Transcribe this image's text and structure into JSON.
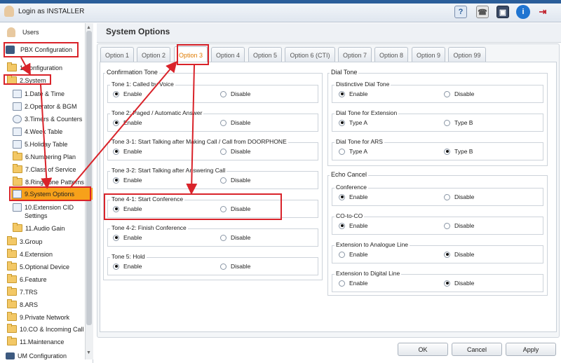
{
  "header": {
    "login_text": "Login as INSTALLER",
    "toolbar_icons": [
      "help-icon",
      "phone-icon",
      "save-icon",
      "info-icon",
      "logout-icon"
    ]
  },
  "sidebar": {
    "items": [
      {
        "label": "Users"
      },
      {
        "label": "PBX Configuration"
      },
      {
        "label": "1.Configuration"
      },
      {
        "label": "2.System"
      },
      {
        "label": "1.Date & Time"
      },
      {
        "label": "2.Operator & BGM"
      },
      {
        "label": "3.Timers & Counters"
      },
      {
        "label": "4.Week Table"
      },
      {
        "label": "5.Holiday Table"
      },
      {
        "label": "6.Numbering Plan"
      },
      {
        "label": "7.Class of Service"
      },
      {
        "label": "8.Ring Tone Patterns"
      },
      {
        "label": "9.System Options"
      },
      {
        "label": "10.Extension CID Settings"
      },
      {
        "label": "11.Audio Gain"
      },
      {
        "label": "3.Group"
      },
      {
        "label": "4.Extension"
      },
      {
        "label": "5.Optional Device"
      },
      {
        "label": "6.Feature"
      },
      {
        "label": "7.TRS"
      },
      {
        "label": "8.ARS"
      },
      {
        "label": "9.Private Network"
      },
      {
        "label": "10.CO & Incoming Call"
      },
      {
        "label": "11.Maintenance"
      },
      {
        "label": "UM Configuration"
      }
    ]
  },
  "main": {
    "title": "System Options",
    "tabs": [
      "Option 1",
      "Option 2",
      "Option 3",
      "Option 4",
      "Option 5",
      "Option 6 (CTI)",
      "Option 7",
      "Option 8",
      "Option 9",
      "Option 99"
    ],
    "active_tab": "Option 3",
    "confirmation_tone": {
      "title": "Confirmation Tone",
      "groups": [
        {
          "title": "Tone 1: Called by Voice",
          "options": [
            "Enable",
            "Disable"
          ],
          "selected": "Enable"
        },
        {
          "title": "Tone 2: Paged / Automatic Answer",
          "options": [
            "Enable",
            "Disable"
          ],
          "selected": "Enable"
        },
        {
          "title": "Tone 3-1: Start Talking after Making Call / Call from DOORPHONE",
          "options": [
            "Enable",
            "Disable"
          ],
          "selected": "Enable"
        },
        {
          "title": "Tone 3-2: Start Talking after Answering Call",
          "options": [
            "Enable",
            "Disable"
          ],
          "selected": "Enable"
        },
        {
          "title": "Tone 4-1: Start Conference",
          "options": [
            "Enable",
            "Disable"
          ],
          "selected": "Enable"
        },
        {
          "title": "Tone 4-2: Finish Conference",
          "options": [
            "Enable",
            "Disable"
          ],
          "selected": "Enable"
        },
        {
          "title": "Tone 5: Hold",
          "options": [
            "Enable",
            "Disable"
          ],
          "selected": "Enable"
        }
      ]
    },
    "dial_tone": {
      "title": "Dial Tone",
      "groups": [
        {
          "title": "Distinctive Dial Tone",
          "options": [
            "Enable",
            "Disable"
          ],
          "selected": "Enable"
        },
        {
          "title": "Dial Tone for Extension",
          "options": [
            "Type A",
            "Type B"
          ],
          "selected": "Type A"
        },
        {
          "title": "Dial Tone for ARS",
          "options": [
            "Type A",
            "Type B"
          ],
          "selected": "Type B"
        }
      ]
    },
    "echo_cancel": {
      "title": "Echo Cancel",
      "groups": [
        {
          "title": "Conference",
          "options": [
            "Enable",
            "Disable"
          ],
          "selected": "Enable"
        },
        {
          "title": "CO-to-CO",
          "options": [
            "Enable",
            "Disable"
          ],
          "selected": "Enable"
        },
        {
          "title": "Extension to Analogue Line",
          "options": [
            "Enable",
            "Disable"
          ],
          "selected": "Disable"
        },
        {
          "title": "Extension to Digital Line",
          "options": [
            "Enable",
            "Disable"
          ],
          "selected": "Disable"
        }
      ]
    },
    "buttons": {
      "ok": "OK",
      "cancel": "Cancel",
      "apply": "Apply"
    }
  },
  "colors": {
    "accent": "#f7a11a",
    "annotation": "#d9232a",
    "active_tab_text": "#e07b00"
  }
}
